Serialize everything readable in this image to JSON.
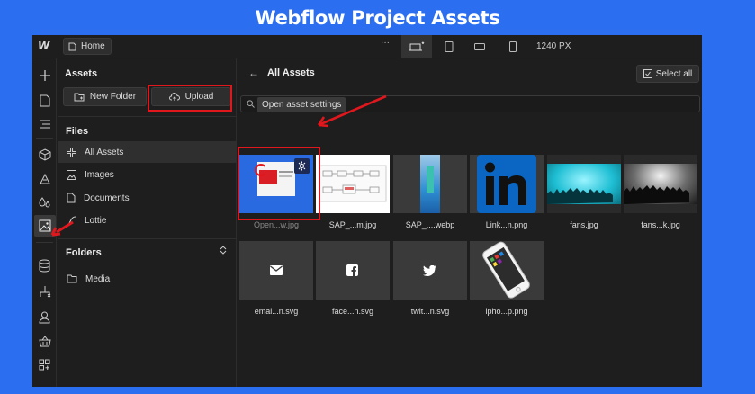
{
  "page_title": "Webflow Project Assets",
  "topbar": {
    "home_label": "Home",
    "more_label": "···",
    "width_label": "1240 PX"
  },
  "panel": {
    "title": "Assets",
    "new_folder_label": "New Folder",
    "upload_label": "Upload",
    "files_heading": "Files",
    "file_items": [
      {
        "label": "All Assets",
        "icon": "grid-icon",
        "selected": true
      },
      {
        "label": "Images",
        "icon": "image-icon"
      },
      {
        "label": "Documents",
        "icon": "document-icon"
      },
      {
        "label": "Lottie",
        "icon": "lottie-icon"
      }
    ],
    "folders_heading": "Folders",
    "folder_items": [
      {
        "label": "Media",
        "icon": "folder-icon"
      }
    ]
  },
  "main": {
    "title": "All Assets",
    "select_all_label": "Select all",
    "search_placeholder": "",
    "tooltip": "Open asset settings",
    "assets": [
      {
        "name": "Open...w.jpg"
      },
      {
        "name": "SAP_...m.jpg"
      },
      {
        "name": "SAP_....webp"
      },
      {
        "name": "Link...n.png"
      },
      {
        "name": "fans.jpg"
      },
      {
        "name": "fans...k.jpg"
      },
      {
        "name": "emai...n.svg"
      },
      {
        "name": "face...n.svg"
      },
      {
        "name": "twit...n.svg"
      },
      {
        "name": "ipho...p.png"
      }
    ]
  },
  "colors": {
    "background": "#2b6ef0",
    "app": "#1e1e1e",
    "highlight": "#e0171d",
    "linkedin": "#0a66c2",
    "fans": "#1fbfd4"
  }
}
